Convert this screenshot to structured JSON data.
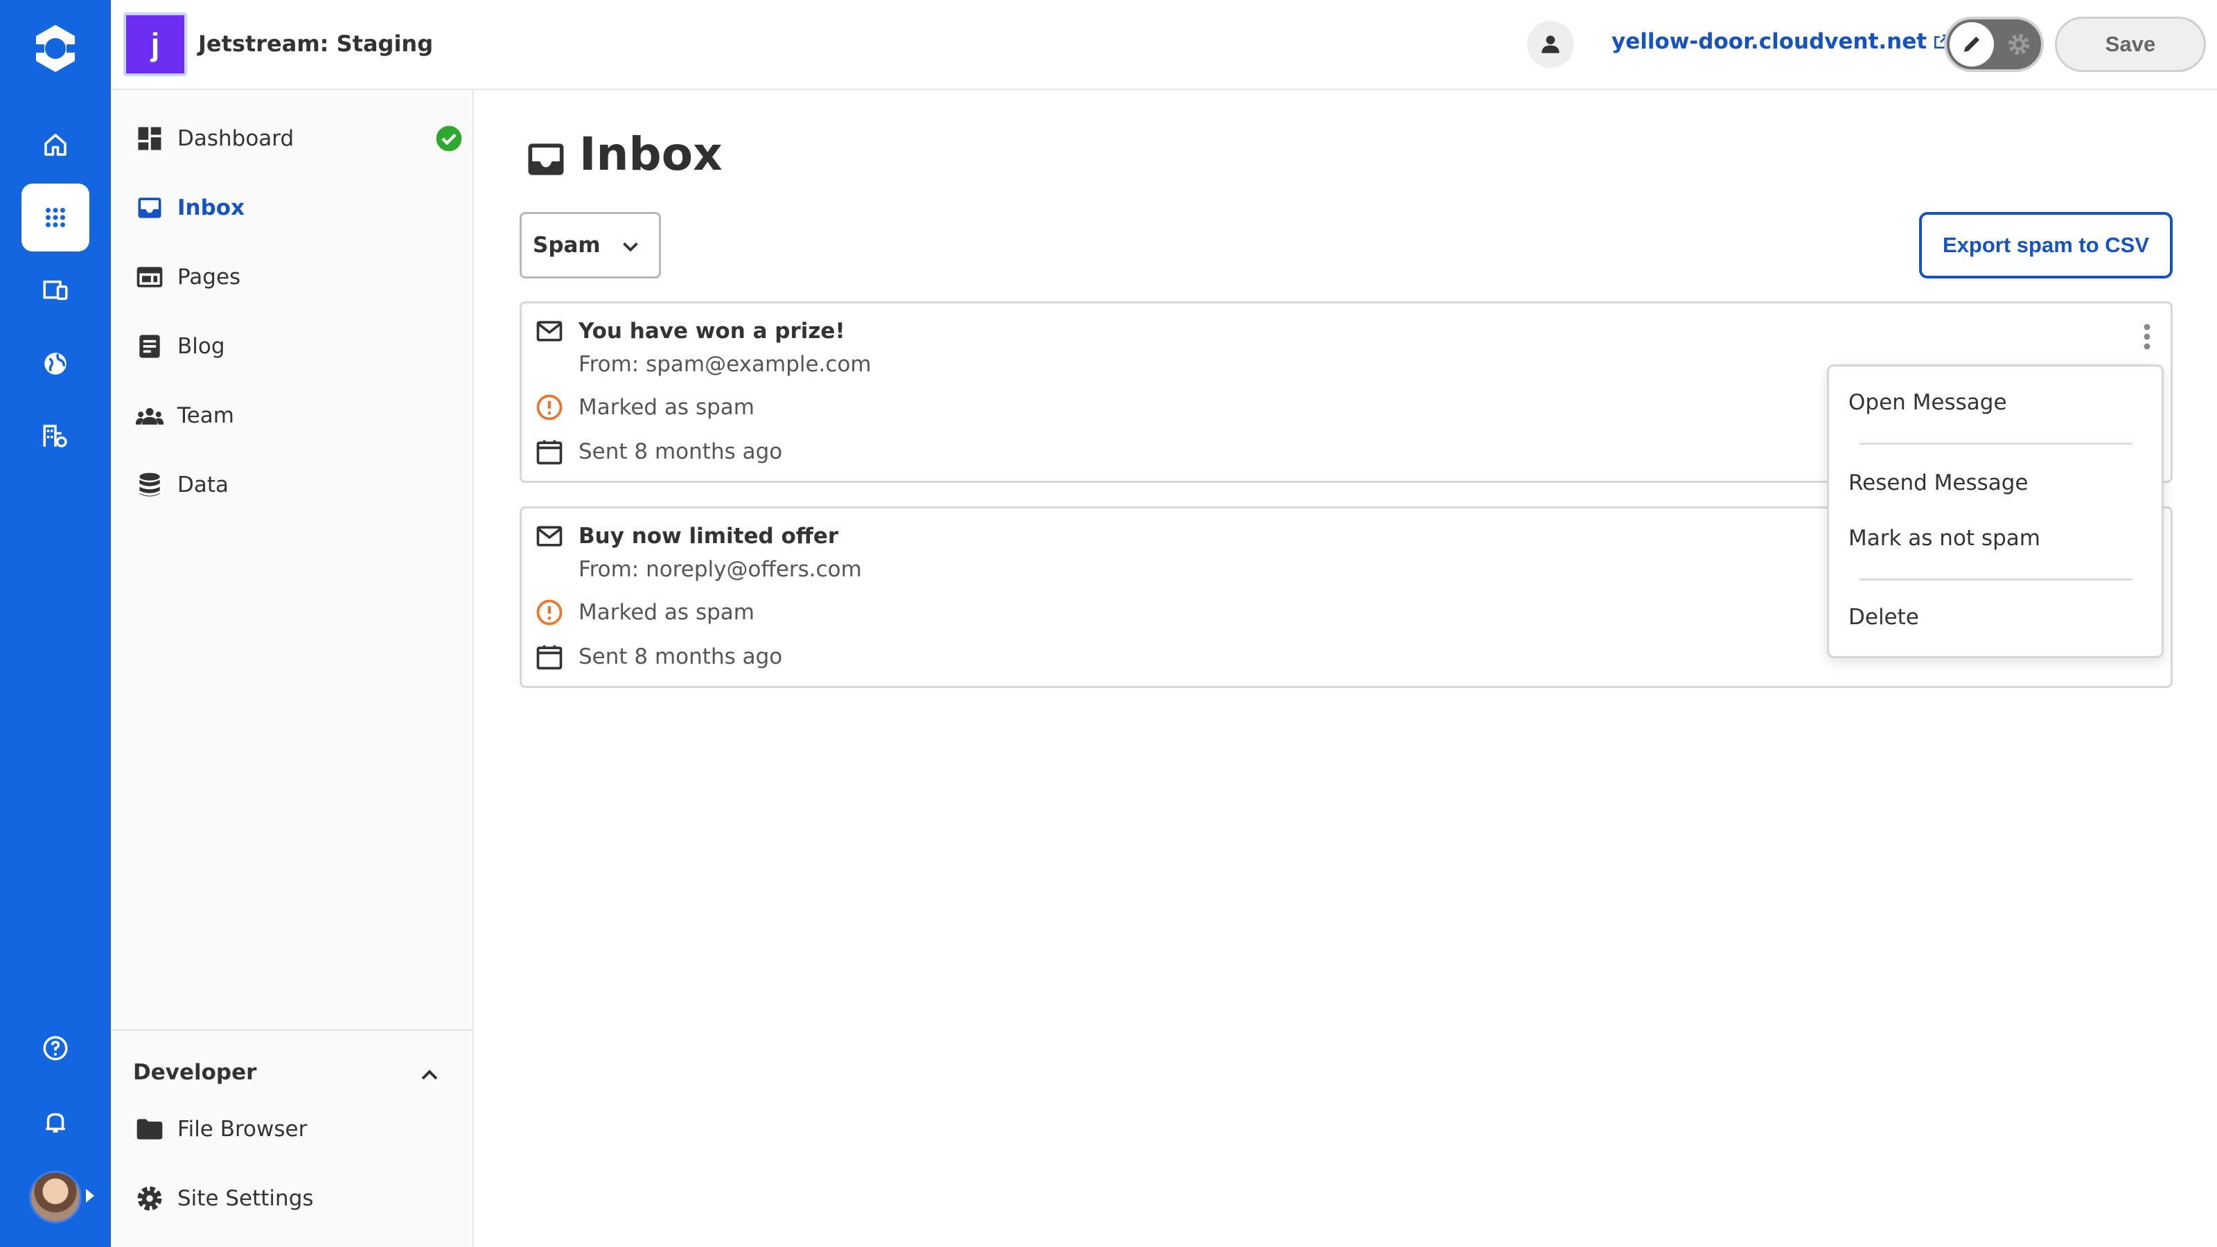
{
  "header": {
    "site_initial": "j",
    "site_title": "Jetstream: Staging",
    "domain": "yellow-door.cloudvent.net",
    "save_label": "Save"
  },
  "rail": {
    "icons": [
      "logo-icon",
      "home-icon",
      "apps-grid-icon",
      "devices-icon",
      "globe-icon",
      "buildings-icon",
      "help-icon",
      "bell-icon",
      "avatar"
    ]
  },
  "sidebar": {
    "items": [
      {
        "label": "Dashboard",
        "icon": "dashboard-icon"
      },
      {
        "label": "Inbox",
        "icon": "inbox-icon"
      },
      {
        "label": "Pages",
        "icon": "pages-icon"
      },
      {
        "label": "Blog",
        "icon": "blog-icon"
      },
      {
        "label": "Team",
        "icon": "team-icon"
      },
      {
        "label": "Data",
        "icon": "database-icon"
      }
    ],
    "developer": {
      "title": "Developer",
      "items": [
        {
          "label": "File Browser",
          "icon": "folder-icon"
        },
        {
          "label": "Site Settings",
          "icon": "gear-icon"
        }
      ]
    }
  },
  "main": {
    "title": "Inbox",
    "filter_value": "Spam",
    "export_label": "Export spam to CSV",
    "messages": [
      {
        "subject": "You have won a prize!",
        "from": "From: spam@example.com",
        "status": "Marked as spam",
        "sent": "Sent 8 months ago"
      },
      {
        "subject": "Buy now limited offer",
        "from": "From: noreply@offers.com",
        "status": "Marked as spam",
        "sent": "Sent 8 months ago"
      }
    ]
  },
  "context_menu": {
    "items": [
      "Open Message",
      "Resend Message",
      "Mark as not spam",
      "Delete"
    ]
  },
  "colors": {
    "rail": "#1366e0",
    "accent": "#1552c4",
    "site_badge": "#6b2ef2",
    "success": "#2ea82e",
    "warning": "#e8762c"
  }
}
